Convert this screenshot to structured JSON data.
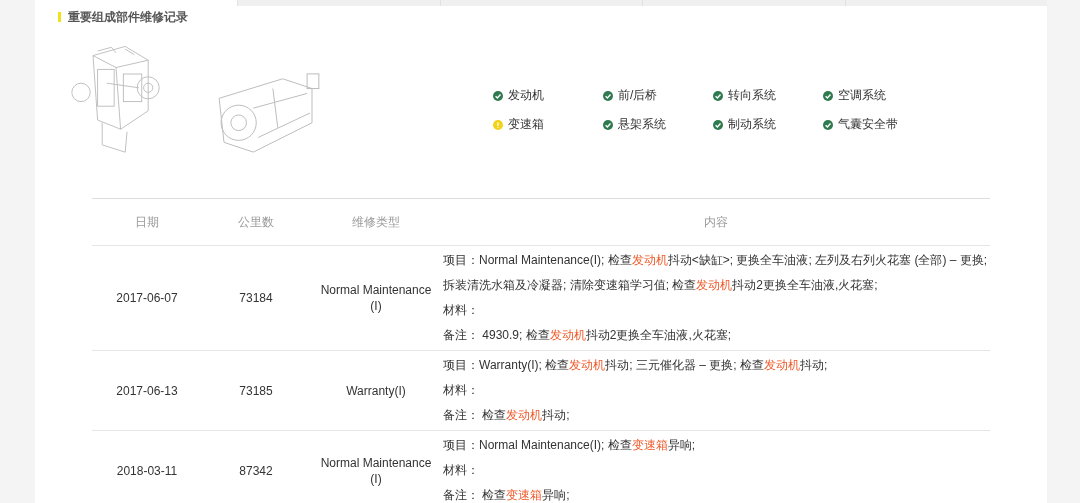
{
  "section_title": "重要组成部件维修记录",
  "components": [
    {
      "label": "发动机",
      "kind": "check"
    },
    {
      "label": "前/后桥",
      "kind": "check"
    },
    {
      "label": "转向系统",
      "kind": "check"
    },
    {
      "label": "空调系统",
      "kind": "check"
    },
    {
      "label": "变速箱",
      "kind": "warning"
    },
    {
      "label": "悬架系统",
      "kind": "check"
    },
    {
      "label": "制动系统",
      "kind": "check"
    },
    {
      "label": "气囊安全带",
      "kind": "check"
    }
  ],
  "table": {
    "columns": [
      "日期",
      "公里数",
      "维修类型",
      "内容"
    ],
    "rows": [
      {
        "date": "2017-06-07",
        "mileage": "73184",
        "type": "Normal Maintenance(I)",
        "lines": [
          [
            {
              "text": "项目：Normal Maintenance(I); 检查",
              "highlight": false
            },
            {
              "text": "发动机",
              "highlight": true
            },
            {
              "text": "抖动<缺缸>; 更换全车油液; 左列及右列火花塞 (全部) – 更换;",
              "highlight": false
            }
          ],
          [
            {
              "text": "拆装清洗水箱及冷凝器; 清除变速箱学习值; 检查",
              "highlight": false
            },
            {
              "text": "发动机",
              "highlight": true
            },
            {
              "text": "抖动2更换全车油液,火花塞;",
              "highlight": false
            }
          ],
          [
            {
              "text": "材料：",
              "highlight": false
            }
          ],
          [
            {
              "text": "备注：  4930.9; 检查",
              "highlight": false
            },
            {
              "text": "发动机",
              "highlight": true
            },
            {
              "text": "抖动2更换全车油液,火花塞;",
              "highlight": false
            }
          ]
        ]
      },
      {
        "date": "2017-06-13",
        "mileage": "73185",
        "type": "Warranty(I)",
        "lines": [
          [
            {
              "text": "项目：Warranty(I); 检查",
              "highlight": false
            },
            {
              "text": "发动机",
              "highlight": true
            },
            {
              "text": "抖动; 三元催化器 – 更换; 检查",
              "highlight": false
            },
            {
              "text": "发动机",
              "highlight": true
            },
            {
              "text": "抖动;",
              "highlight": false
            }
          ],
          [
            {
              "text": "材料：",
              "highlight": false
            }
          ],
          [
            {
              "text": "备注：  检查",
              "highlight": false
            },
            {
              "text": "发动机",
              "highlight": true
            },
            {
              "text": "抖动;",
              "highlight": false
            }
          ]
        ]
      },
      {
        "date": "2018-03-11",
        "mileage": "87342",
        "type": "Normal Maintenance(I)",
        "lines": [
          [
            {
              "text": "项目：Normal Maintenance(I); 检查",
              "highlight": false
            },
            {
              "text": "变速箱",
              "highlight": true
            },
            {
              "text": "异响;",
              "highlight": false
            }
          ],
          [
            {
              "text": "材料：",
              "highlight": false
            }
          ],
          [
            {
              "text": "备注：  检查",
              "highlight": false
            },
            {
              "text": "变速箱",
              "highlight": true
            },
            {
              "text": "异响;",
              "highlight": false
            }
          ]
        ]
      }
    ]
  }
}
